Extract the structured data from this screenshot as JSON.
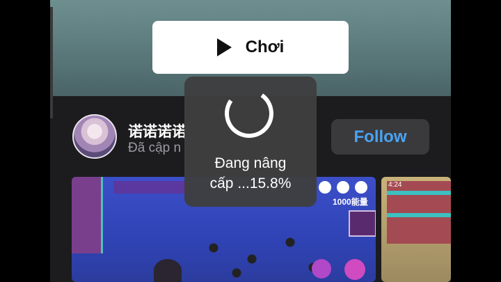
{
  "player": {
    "play_label": "Chơi",
    "play_icon": "play-icon"
  },
  "profile": {
    "name": "诺诺诺诺",
    "subtitle": "Đã cập n",
    "follow_label": "Follow"
  },
  "loading": {
    "line1": "Đang nâng",
    "line2": "cấp ...15.8%",
    "progress_percent": 15.8
  },
  "thumbnails": {
    "main_count": "1000能量",
    "side_time": "4:24"
  },
  "colors": {
    "follow_text": "#4aa3f2",
    "dark_bg": "#1c1c1e",
    "overlay_bg": "#3e3e40"
  }
}
